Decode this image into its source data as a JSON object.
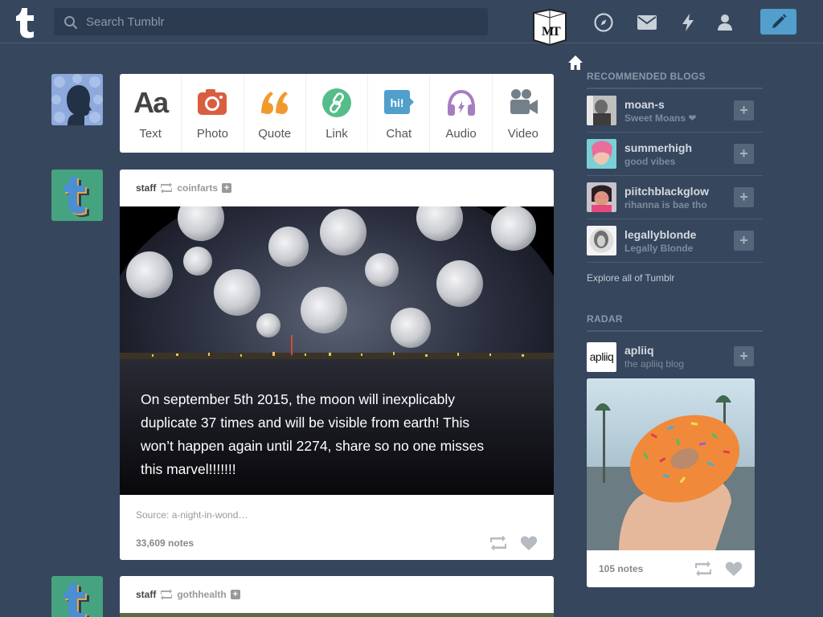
{
  "header": {
    "search_placeholder": "Search Tumblr",
    "avatar_initials": "MT"
  },
  "post_types": [
    {
      "label": "Text",
      "icon": "text-icon",
      "color": "#444444"
    },
    {
      "label": "Photo",
      "icon": "camera-icon",
      "color": "#d95e40"
    },
    {
      "label": "Quote",
      "icon": "quote-icon",
      "color": "#f2992e"
    },
    {
      "label": "Link",
      "icon": "link-icon",
      "color": "#56bc8a"
    },
    {
      "label": "Chat",
      "icon": "chat-icon",
      "color": "#529ecc"
    },
    {
      "label": "Audio",
      "icon": "headphones-icon",
      "color": "#a77dc2"
    },
    {
      "label": "Video",
      "icon": "video-camera-icon",
      "color": "#748089"
    }
  ],
  "posts": [
    {
      "user": "staff",
      "reblogged_from": "coinfarts",
      "caption": "On september 5th 2015, the moon will inexplicably duplicate 37 times and will be visible from earth! This won’t happen again until 2274, share so no one misses this marvel!!!!!!!",
      "source": "Source: a-night-in-wond…",
      "notes": "33,609 notes"
    },
    {
      "user": "staff",
      "reblogged_from": "gothhealth"
    }
  ],
  "sidebar": {
    "recommended_title": "RECOMMENDED BLOGS",
    "recommended": [
      {
        "name": "moan-s",
        "subtitle": "Sweet Moans ❤"
      },
      {
        "name": "summerhigh",
        "subtitle": "good vibes"
      },
      {
        "name": "piitchblackglow",
        "subtitle": "rihanna is bae tho"
      },
      {
        "name": "legallyblonde",
        "subtitle": "Legally Blonde"
      }
    ],
    "explore": "Explore all of Tumblr",
    "radar_title": "RADAR",
    "radar": {
      "name": "apliiq",
      "subtitle": "the apliiq blog",
      "avatar_text": "apliiq",
      "notes": "105 notes"
    }
  },
  "colors": {
    "background": "#36465d",
    "compose": "#529ecc"
  }
}
